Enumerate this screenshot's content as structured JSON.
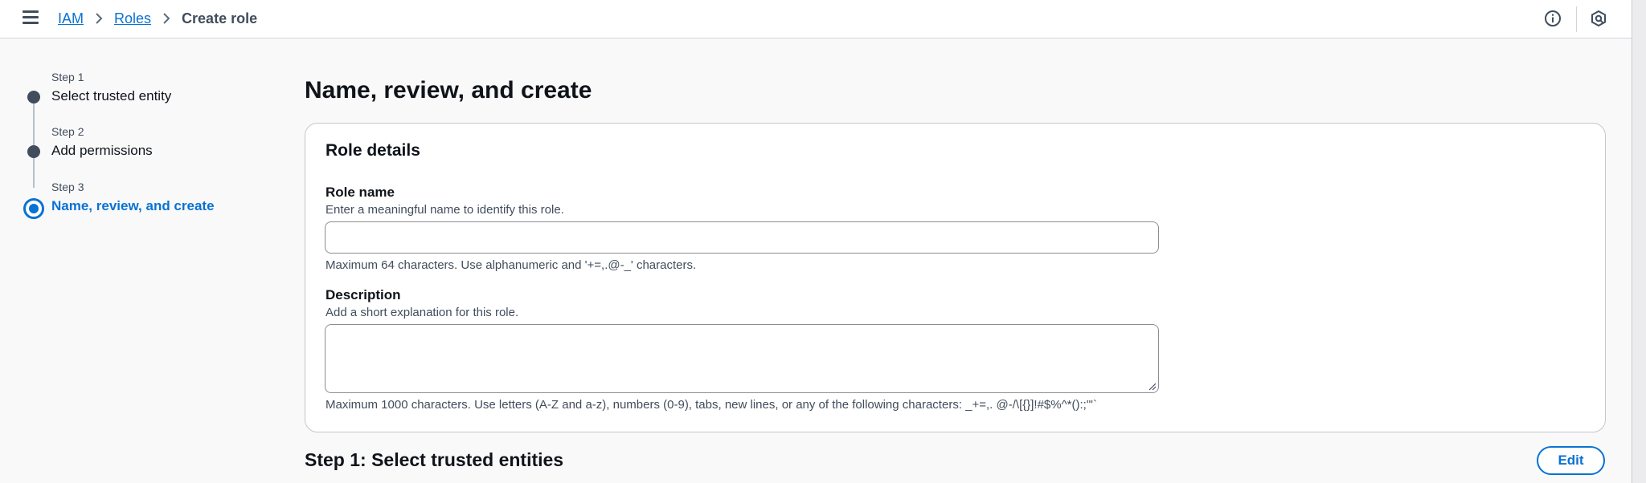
{
  "breadcrumb": {
    "items": [
      "IAM",
      "Roles"
    ],
    "current": "Create role"
  },
  "icons": {
    "menu": "hamburger-menu-icon",
    "info": "info-icon",
    "settings": "hexagon-settings-icon",
    "separator": "chevron-right-icon"
  },
  "steps": [
    {
      "step": "Step 1",
      "label": "Select trusted entity",
      "state": "complete"
    },
    {
      "step": "Step 2",
      "label": "Add permissions",
      "state": "complete"
    },
    {
      "step": "Step 3",
      "label": "Name, review, and create",
      "state": "active"
    }
  ],
  "page": {
    "title": "Name, review, and create"
  },
  "role_details": {
    "heading": "Role details",
    "role_name": {
      "label": "Role name",
      "description": "Enter a meaningful name to identify this role.",
      "value": "",
      "constraint": "Maximum 64 characters. Use alphanumeric and '+=,.@-_' characters."
    },
    "description": {
      "label": "Description",
      "description": "Add a short explanation for this role.",
      "value": "",
      "constraint": "Maximum 1000 characters. Use letters (A-Z and a-z), numbers (0-9), tabs, new lines, or any of the following characters: _+=,. @-/\\[{}]!#$%^*():;\"'`"
    }
  },
  "step1_section": {
    "title": "Step 1: Select trusted entities",
    "edit_label": "Edit"
  },
  "colors": {
    "accent": "#0972d3",
    "text": "#0f141a",
    "muted": "#414d5c",
    "background": "#f9f9fa"
  }
}
